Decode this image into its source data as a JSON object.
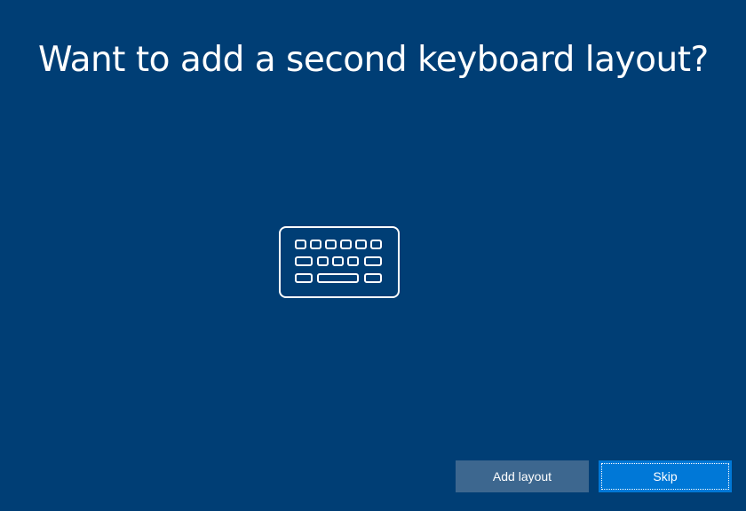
{
  "page": {
    "title": "Want to add a second keyboard layout?",
    "background_color": "#003e75"
  },
  "illustration": {
    "icon": "keyboard-icon"
  },
  "actions": {
    "add_layout_label": "Add layout",
    "skip_label": "Skip",
    "primary_color": "#0078d7",
    "secondary_color": "#3d678f"
  }
}
